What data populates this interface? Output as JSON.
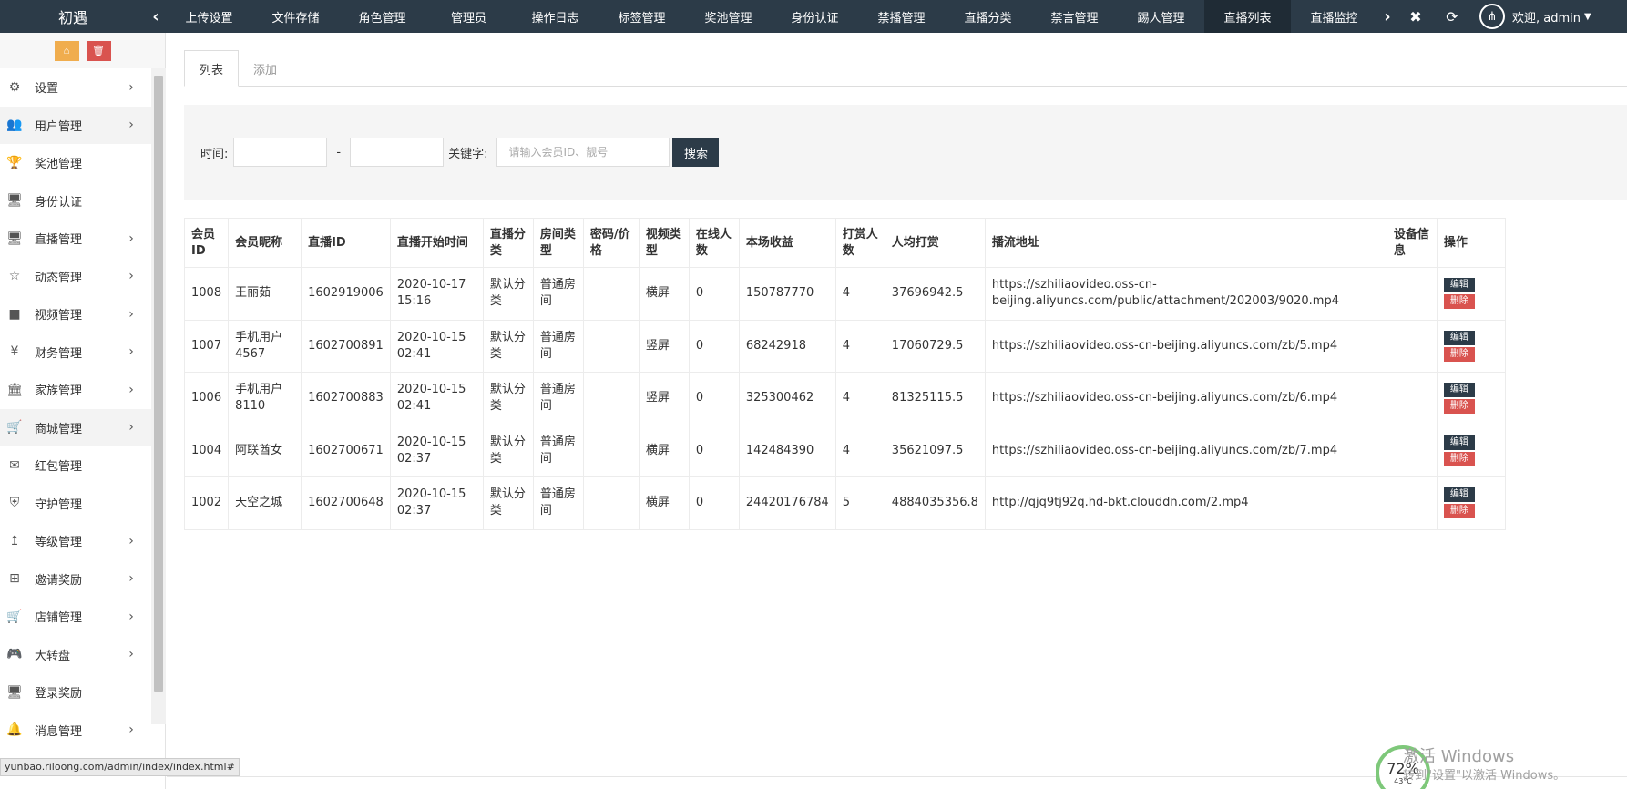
{
  "topbar": {
    "logo": "初遇",
    "prev_icon": "chevron-left-icon",
    "next_icon": "chevron-right-icon",
    "tabs": [
      {
        "label": "上传设置"
      },
      {
        "label": "文件存储"
      },
      {
        "label": "角色管理"
      },
      {
        "label": "管理员"
      },
      {
        "label": "操作日志"
      },
      {
        "label": "标签管理"
      },
      {
        "label": "奖池管理"
      },
      {
        "label": "身份认证"
      },
      {
        "label": "禁播管理"
      },
      {
        "label": "直播分类"
      },
      {
        "label": "禁言管理"
      },
      {
        "label": "踢人管理"
      },
      {
        "label": "直播列表",
        "active": true
      },
      {
        "label": "直播监控"
      }
    ],
    "close_glyph": "✖",
    "refresh_glyph": "⟳",
    "welcome": "欢迎, admin"
  },
  "sidebar": {
    "items": [
      {
        "label": "设置",
        "icon": "gears-icon",
        "glyph": "⚙",
        "has_children": true
      },
      {
        "label": "用户管理",
        "icon": "users-icon",
        "glyph": "👥",
        "has_children": true,
        "active": true
      },
      {
        "label": "奖池管理",
        "icon": "trophy-icon",
        "glyph": "🏆",
        "has_children": false
      },
      {
        "label": "身份认证",
        "icon": "monitor-icon",
        "glyph": "🖥",
        "has_children": false
      },
      {
        "label": "直播管理",
        "icon": "monitor-icon",
        "glyph": "🖥",
        "has_children": true
      },
      {
        "label": "动态管理",
        "icon": "star-icon",
        "glyph": "☆",
        "has_children": true
      },
      {
        "label": "视频管理",
        "icon": "video-camera-icon",
        "glyph": "■",
        "has_children": true
      },
      {
        "label": "财务管理",
        "icon": "yen-icon",
        "glyph": "¥",
        "has_children": true
      },
      {
        "label": "家族管理",
        "icon": "bank-icon",
        "glyph": "🏛",
        "has_children": true
      },
      {
        "label": "商城管理",
        "icon": "cart-icon",
        "glyph": "🛒",
        "has_children": true,
        "active": true
      },
      {
        "label": "红包管理",
        "icon": "envelope-icon",
        "glyph": "✉",
        "has_children": false
      },
      {
        "label": "守护管理",
        "icon": "shield-icon",
        "glyph": "⛨",
        "has_children": false
      },
      {
        "label": "等级管理",
        "icon": "level-up-icon",
        "glyph": "↥",
        "has_children": true
      },
      {
        "label": "邀请奖励",
        "icon": "sitemap-icon",
        "glyph": "⊞",
        "has_children": true
      },
      {
        "label": "店铺管理",
        "icon": "cart-icon",
        "glyph": "🛒",
        "has_children": true
      },
      {
        "label": "大转盘",
        "icon": "gamepad-icon",
        "glyph": "🎮",
        "has_children": true
      },
      {
        "label": "登录奖励",
        "icon": "monitor-icon",
        "glyph": "🖥",
        "has_children": false
      },
      {
        "label": "消息管理",
        "icon": "bell-icon",
        "glyph": "🔔",
        "has_children": true
      }
    ]
  },
  "main": {
    "tabs": [
      {
        "label": "列表",
        "active": true
      },
      {
        "label": "添加",
        "active": false
      }
    ],
    "search": {
      "time_label": "时间:",
      "dash": "-",
      "keyword_label": "关键字:",
      "keyword_placeholder": "请输入会员ID、靓号",
      "search_button": "搜索"
    },
    "table": {
      "headers": [
        {
          "label": "会员ID",
          "width": 45
        },
        {
          "label": "会员昵称",
          "width": 80
        },
        {
          "label": "直播ID",
          "width": 83
        },
        {
          "label": "直播开始时间",
          "width": 102
        },
        {
          "label": "直播分类",
          "width": 55
        },
        {
          "label": "房间类型",
          "width": 55
        },
        {
          "label": "密码/价格",
          "width": 61
        },
        {
          "label": "视频类型",
          "width": 55
        },
        {
          "label": "在线人数",
          "width": 55
        },
        {
          "label": "本场收益",
          "width": 90
        },
        {
          "label": "打赏人数",
          "width": 54
        },
        {
          "label": "人均打赏",
          "width": 92
        },
        {
          "label": "播流地址",
          "width": 441
        },
        {
          "label": "设备信息",
          "width": 55
        },
        {
          "label": "操作",
          "width": 75
        }
      ],
      "edit_label": "编辑",
      "delete_label": "删除",
      "rows": [
        {
          "uid": "1008",
          "nickname": "王丽茹",
          "live_id": "1602919006",
          "start_time": "2020-10-17 15:16",
          "category": "默认分类",
          "room_type": "普通房间",
          "password_price": "",
          "video_type": "横屏",
          "online": "0",
          "income": "150787770",
          "tippers": "4",
          "avg_tip": "37696942.5",
          "stream_url": "https://szhiliaovideo.oss-cn-beijing.aliyuncs.com/public/attachment/202003/9020.mp4",
          "device": ""
        },
        {
          "uid": "1007",
          "nickname": "手机用户4567",
          "live_id": "1602700891",
          "start_time": "2020-10-15 02:41",
          "category": "默认分类",
          "room_type": "普通房间",
          "password_price": "",
          "video_type": "竖屏",
          "online": "0",
          "income": "68242918",
          "tippers": "4",
          "avg_tip": "17060729.5",
          "stream_url": "https://szhiliaovideo.oss-cn-beijing.aliyuncs.com/zb/5.mp4",
          "device": ""
        },
        {
          "uid": "1006",
          "nickname": "手机用户8110",
          "live_id": "1602700883",
          "start_time": "2020-10-15 02:41",
          "category": "默认分类",
          "room_type": "普通房间",
          "password_price": "",
          "video_type": "竖屏",
          "online": "0",
          "income": "325300462",
          "tippers": "4",
          "avg_tip": "81325115.5",
          "stream_url": "https://szhiliaovideo.oss-cn-beijing.aliyuncs.com/zb/6.mp4",
          "device": ""
        },
        {
          "uid": "1004",
          "nickname": "阿联酋女",
          "live_id": "1602700671",
          "start_time": "2020-10-15 02:37",
          "category": "默认分类",
          "room_type": "普通房间",
          "password_price": "",
          "video_type": "横屏",
          "online": "0",
          "income": "142484390",
          "tippers": "4",
          "avg_tip": "35621097.5",
          "stream_url": "https://szhiliaovideo.oss-cn-beijing.aliyuncs.com/zb/7.mp4",
          "device": ""
        },
        {
          "uid": "1002",
          "nickname": "天空之城",
          "live_id": "1602700648",
          "start_time": "2020-10-15 02:37",
          "category": "默认分类",
          "room_type": "普通房间",
          "password_price": "",
          "video_type": "横屏",
          "online": "0",
          "income": "24420176784",
          "tippers": "5",
          "avg_tip": "4884035356.8",
          "stream_url": "http://qjq9tj92q.hd-bkt.clouddn.com/2.mp4",
          "device": ""
        }
      ]
    }
  },
  "statusbar": {
    "url": "yunbao.riloong.com/admin/index/index.html#"
  },
  "system": {
    "watermark_title": "激活 Windows",
    "watermark_sub": "转到\"设置\"以激活 Windows。",
    "gauge_value": "72%",
    "gauge_temp": "43°C",
    "gauge_color": "#7ec87a"
  }
}
